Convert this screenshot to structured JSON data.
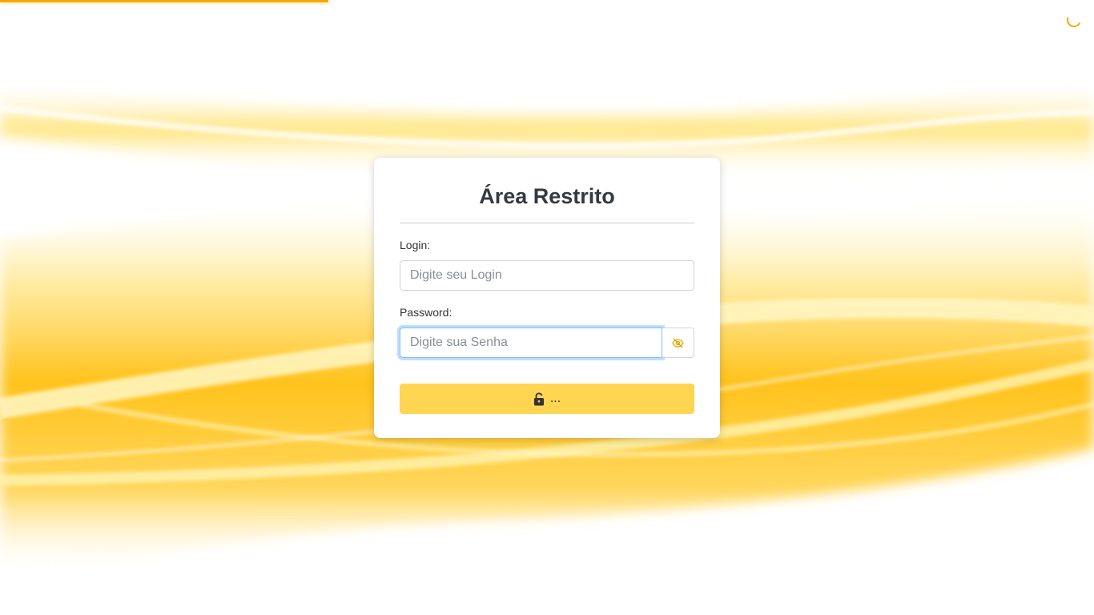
{
  "page": {
    "progress_percent": 30
  },
  "login_card": {
    "title": "Área Restrito",
    "login_label": "Login:",
    "login_placeholder": "Digite seu Login",
    "login_value": "",
    "password_label": "Password:",
    "password_placeholder": "Digite sua Senha",
    "password_value": "",
    "submit_label": "...",
    "icons": {
      "eye_toggle": "eye-slash-icon",
      "submit": "lock-open-icon"
    }
  },
  "colors": {
    "accent": "#f7a800",
    "button_bg": "#ffd551",
    "focus_border": "#80bdff"
  }
}
